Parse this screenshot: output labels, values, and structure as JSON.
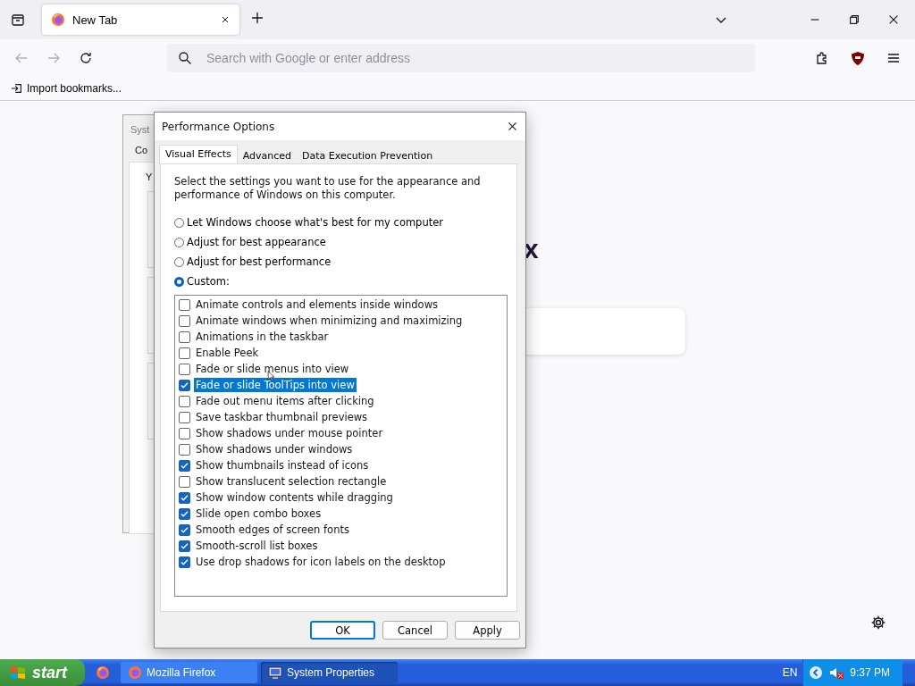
{
  "browser": {
    "tabs": [
      {
        "label": "New Tab",
        "selected": true
      }
    ],
    "url_field": {
      "placeholder": "Search with Google or enter address"
    },
    "bookmarks": [
      {
        "label": "Import bookmarks..."
      }
    ],
    "page": {
      "logo_fragment": "x"
    }
  },
  "background_window": {
    "title": "Syst",
    "tab": "Co",
    "text": "Y"
  },
  "dialog": {
    "title": "Performance Options",
    "tabs": [
      {
        "label": "Visual Effects",
        "selected": true
      },
      {
        "label": "Advanced",
        "selected": false
      },
      {
        "label": "Data Execution Prevention",
        "selected": false
      }
    ],
    "description": "Select the settings you want to use for the appearance and performance of Windows on this computer.",
    "options": [
      {
        "label": "Let Windows choose what's best for my computer",
        "selected": false
      },
      {
        "label": "Adjust for best appearance",
        "selected": false
      },
      {
        "label": "Adjust for best performance",
        "selected": false
      },
      {
        "label": "Custom:",
        "selected": true
      }
    ],
    "effects": [
      {
        "label": "Animate controls and elements inside windows",
        "checked": false,
        "selected": false
      },
      {
        "label": "Animate windows when minimizing and maximizing",
        "checked": false,
        "selected": false
      },
      {
        "label": "Animations in the taskbar",
        "checked": false,
        "selected": false
      },
      {
        "label": "Enable Peek",
        "checked": false,
        "selected": false
      },
      {
        "label": "Fade or slide menus into view",
        "checked": false,
        "selected": false
      },
      {
        "label": "Fade or slide ToolTips into view",
        "checked": true,
        "selected": true
      },
      {
        "label": "Fade out menu items after clicking",
        "checked": false,
        "selected": false
      },
      {
        "label": "Save taskbar thumbnail previews",
        "checked": false,
        "selected": false
      },
      {
        "label": "Show shadows under mouse pointer",
        "checked": false,
        "selected": false
      },
      {
        "label": "Show shadows under windows",
        "checked": false,
        "selected": false
      },
      {
        "label": "Show thumbnails instead of icons",
        "checked": true,
        "selected": false
      },
      {
        "label": "Show translucent selection rectangle",
        "checked": false,
        "selected": false
      },
      {
        "label": "Show window contents while dragging",
        "checked": true,
        "selected": false
      },
      {
        "label": "Slide open combo boxes",
        "checked": true,
        "selected": false
      },
      {
        "label": "Smooth edges of screen fonts",
        "checked": true,
        "selected": false
      },
      {
        "label": "Smooth-scroll list boxes",
        "checked": true,
        "selected": false
      },
      {
        "label": "Use drop shadows for icon labels on the desktop",
        "checked": true,
        "selected": false
      }
    ],
    "buttons": [
      {
        "label": "OK",
        "kind": "default"
      },
      {
        "label": "Cancel",
        "kind": "normal"
      },
      {
        "label": "Apply",
        "kind": "normal"
      }
    ]
  },
  "taskbar": {
    "start": "start",
    "tasks": [
      {
        "label": "Mozilla Firefox",
        "selected": false
      },
      {
        "label": "System Properties",
        "selected": true
      }
    ],
    "language": "EN",
    "clock": "9:37 PM"
  }
}
